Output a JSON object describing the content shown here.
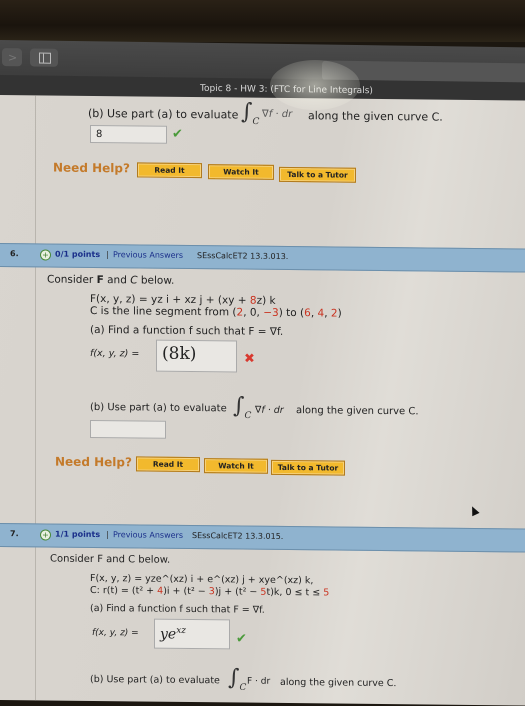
{
  "browser": {
    "tab_title": "Topic 8 - HW 3: (FTC for Line Integrals)",
    "icons": [
      "forward-icon",
      "sidebar-icon"
    ]
  },
  "prev_question": {
    "part_b_prefix": "(b) Use part (a) to evaluate",
    "integral_sub": "C",
    "integrand": "∇f · dr",
    "part_b_suffix": "along the given curve C.",
    "answer_b": "8",
    "answer_b_status": "correct"
  },
  "help": {
    "label": "Need Help?",
    "read_it": "Read It",
    "watch_it": "Watch It",
    "tutor": "Talk to a Tutor"
  },
  "q6": {
    "number": "6.",
    "points": "0/1 points",
    "separator": "|",
    "previous_answers": "Previous Answers",
    "source": "SEssCalcET2 13.3.013.",
    "intro_1": "Consider ",
    "intro_F": "F",
    "intro_2": " and ",
    "intro_C": "C",
    "intro_3": " below.",
    "field": "F(x, y, z) = yz i + xz j + (xy + ",
    "field_red": "8",
    "field_end": "z) k",
    "curve_pre": "C is the line segment from (",
    "curve_p1": "2",
    "curve_mid1": ", 0, ",
    "curve_p2": "−3",
    "curve_mid2": ") to (",
    "curve_p3": "6",
    "curve_mid3": ", ",
    "curve_p4": "4",
    "curve_mid4": ", ",
    "curve_p5": "2",
    "curve_end": ")",
    "part_a": "(a) Find a function f such that F = ∇f.",
    "f_label": "f(x, y, z) =",
    "answer_a": "(8k)",
    "answer_a_status": "incorrect",
    "part_b_prefix": "(b) Use part (a) to evaluate",
    "integral_sub": "C",
    "integrand": "∇f · dr",
    "part_b_suffix": "along the given curve C.",
    "answer_b": ""
  },
  "q7": {
    "number": "7.",
    "points": "1/1 points",
    "separator": "|",
    "previous_answers": "Previous Answers",
    "source": "SEssCalcET2 13.3.015.",
    "intro": "Consider F and C below.",
    "field": "F(x, y, z) = yze^(xz) i + e^(xz) j + xye^(xz) k,",
    "curve_pre": "C: r(t) = (t² + ",
    "curve_r1": "4",
    "curve_mid1": ")i + (t² − ",
    "curve_r2": "3",
    "curve_mid2": ")j + (t² − ",
    "curve_r3": "5",
    "curve_mid3": "t)k,   0 ≤ t ≤ ",
    "curve_r4": "5",
    "part_a": "(a) Find a function f such that F = ∇f.",
    "f_label": "f(x, y, z) =",
    "answer_a_base": "ye",
    "answer_a_sup": "xz",
    "answer_a_status": "correct",
    "part_b_prefix": "(b) Use part (a) to evaluate",
    "integral_sub": "C",
    "integrand": "F · dr",
    "part_b_suffix": "along the given curve C."
  },
  "status_colors": {
    "correct": "#4a9a3a",
    "incorrect": "#d8392f",
    "header_bar": "#8fb3cf",
    "help_button": "#f2b92d",
    "need_help": "#c47a2a",
    "link": "#1a2f8a"
  }
}
